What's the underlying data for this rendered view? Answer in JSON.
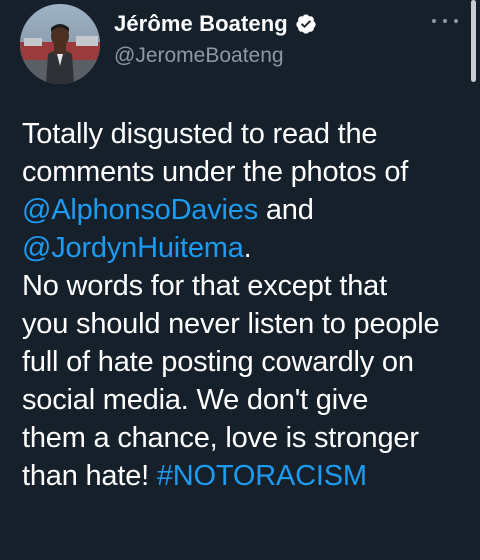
{
  "author": {
    "display_name": "Jérôme Boateng",
    "handle": "@JeromeBoateng",
    "verified": true,
    "avatar_icon": "profile-photo",
    "more_icon": "ellipsis-icon"
  },
  "tweet": {
    "line1": "Totally disgusted to read the",
    "line2": "comments under the photos of",
    "mention1": "@AlphonsoDavies",
    "and": " and",
    "mention2": "@JordynHuitema",
    "period": ".",
    "line5": "No words for that except that",
    "line6": "you should never listen to people",
    "line7": "full of hate posting cowardly on",
    "line8": "social media. We don't give",
    "line9": "them a chance, love is stronger",
    "line10_prefix": "than hate! ",
    "hashtag": "#NOTORACISM"
  },
  "colors": {
    "background": "#15202b",
    "text": "#ffffff",
    "secondary_text": "#8b98a5",
    "link": "#1d9bf0",
    "verified_badge": "#ffffff"
  }
}
